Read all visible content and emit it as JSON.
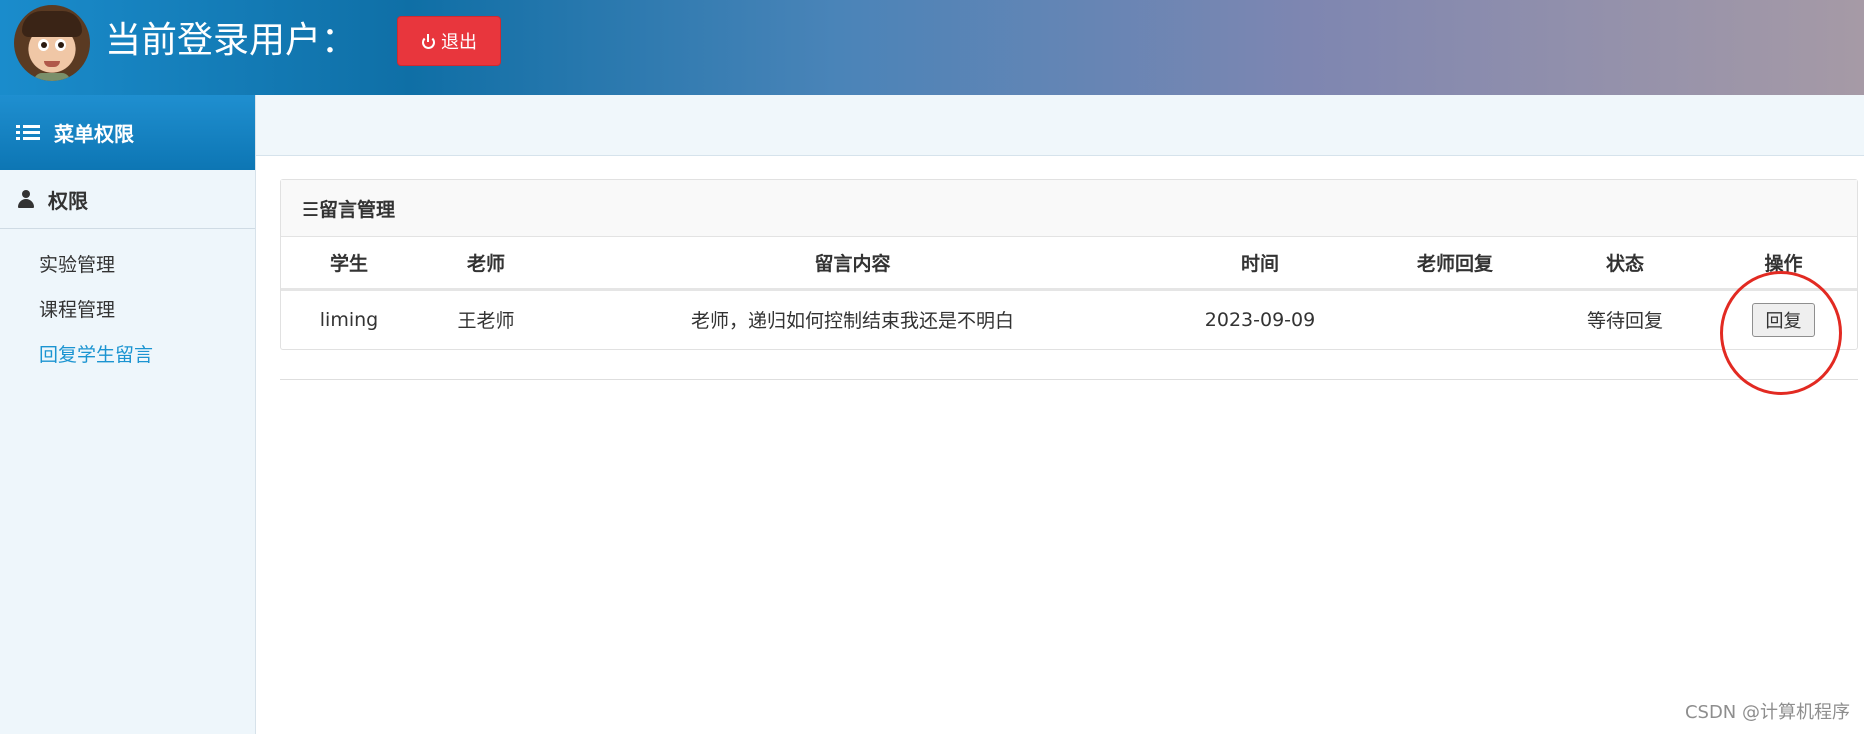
{
  "header": {
    "user_label": "当前登录用户：",
    "logout_label": "退出"
  },
  "sidebar": {
    "menu_title": "菜单权限",
    "group_title": "权限",
    "items": [
      {
        "label": "实验管理"
      },
      {
        "label": "课程管理"
      },
      {
        "label": "回复学生留言"
      }
    ]
  },
  "panel": {
    "title": "☰留言管理",
    "columns": [
      "学生",
      "老师",
      "留言内容",
      "时间",
      "老师回复",
      "状态",
      "操作"
    ],
    "rows": [
      {
        "student": "liming",
        "teacher": "王老师",
        "content": "老师，递归如何控制结束我还是不明白",
        "time": "2023-09-09",
        "reply": "",
        "status": "等待回复",
        "action": "回复"
      }
    ]
  },
  "watermark": "CSDN @计算机程序",
  "colors": {
    "accent": "#1b94d1",
    "logout": "#e8363d",
    "highlight": "#e22a22"
  }
}
